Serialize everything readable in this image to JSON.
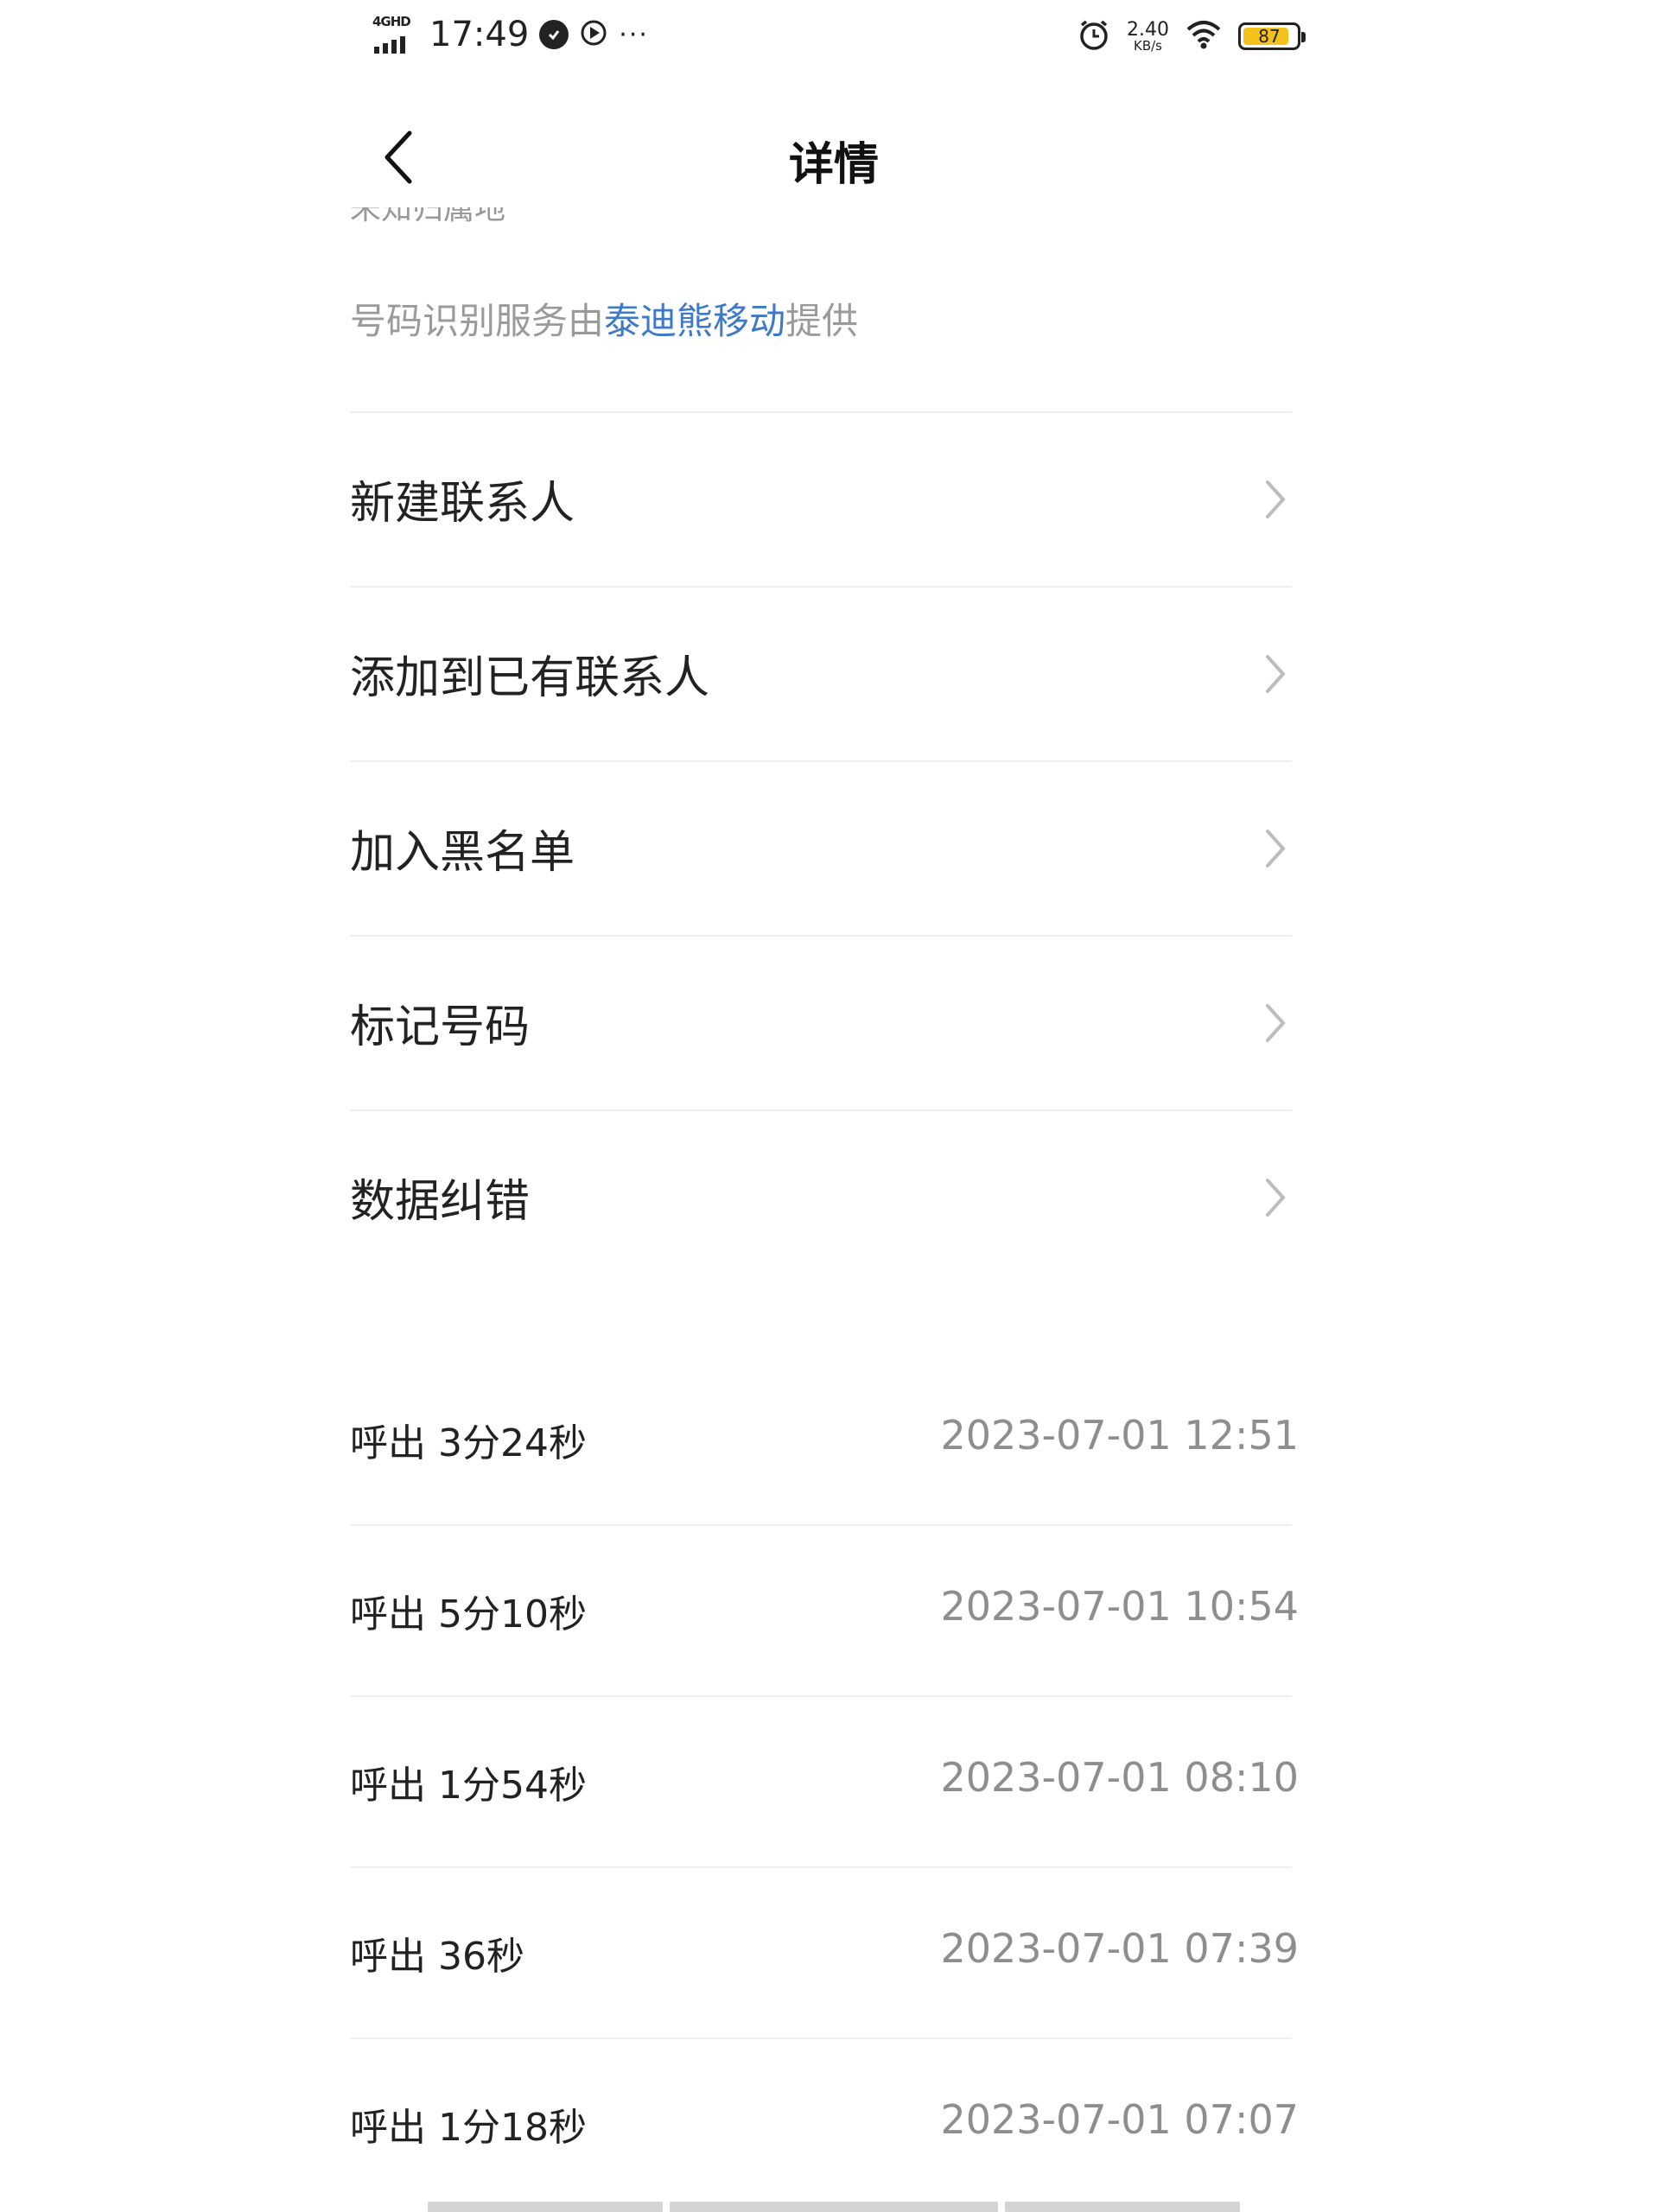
{
  "status_bar": {
    "network": "4GHD",
    "time": "17:49",
    "more": "···",
    "speed_value": "2.40",
    "speed_unit": "KB/s",
    "battery": "87",
    "battery_level_percent": 87
  },
  "header": {
    "title": "详情"
  },
  "info": {
    "cut_text": "未知归属地",
    "provider_prefix": "号码识别服务由",
    "provider_link": "泰迪熊移动",
    "provider_suffix": "提供"
  },
  "menu": [
    {
      "label": "新建联系人"
    },
    {
      "label": "添加到已有联系人"
    },
    {
      "label": "加入黑名单"
    },
    {
      "label": "标记号码"
    },
    {
      "label": "数据纠错"
    }
  ],
  "calls": [
    {
      "type": "呼出 3分24秒",
      "datetime": "2023-07-01 12:51"
    },
    {
      "type": "呼出 5分10秒",
      "datetime": "2023-07-01 10:54"
    },
    {
      "type": "呼出 1分54秒",
      "datetime": "2023-07-01 08:10"
    },
    {
      "type": "呼出 36秒",
      "datetime": "2023-07-01 07:39"
    },
    {
      "type": "呼出 1分18秒",
      "datetime": "2023-07-01 07:07"
    }
  ]
}
